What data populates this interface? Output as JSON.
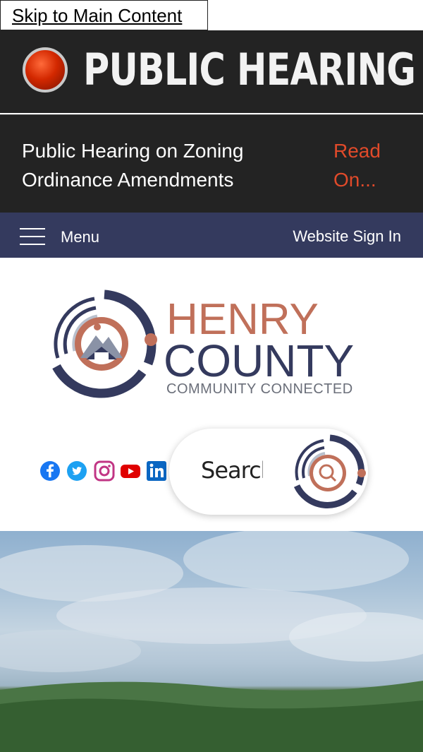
{
  "skip_link": {
    "label": "Skip to Main Content"
  },
  "alert": {
    "title": "PUBLIC HEARING",
    "message": "Public Hearing on Zoning Ordinance Amendments",
    "link_label": "Read On...",
    "link_color": "#e04a2a",
    "background": "#232323"
  },
  "nav": {
    "menu_label": "Menu",
    "sign_in_label": "Website Sign In",
    "background": "#343a5e"
  },
  "logo": {
    "line1": "HENRY",
    "line2": "COUNTY",
    "tagline": "COMMUNITY CONNECTED",
    "accent": "#c0705a",
    "primary": "#343a5e"
  },
  "social": {
    "icons": [
      "facebook-icon",
      "twitter-icon",
      "instagram-icon",
      "youtube-icon",
      "linkedin-icon"
    ]
  },
  "search": {
    "placeholder": "Search"
  }
}
